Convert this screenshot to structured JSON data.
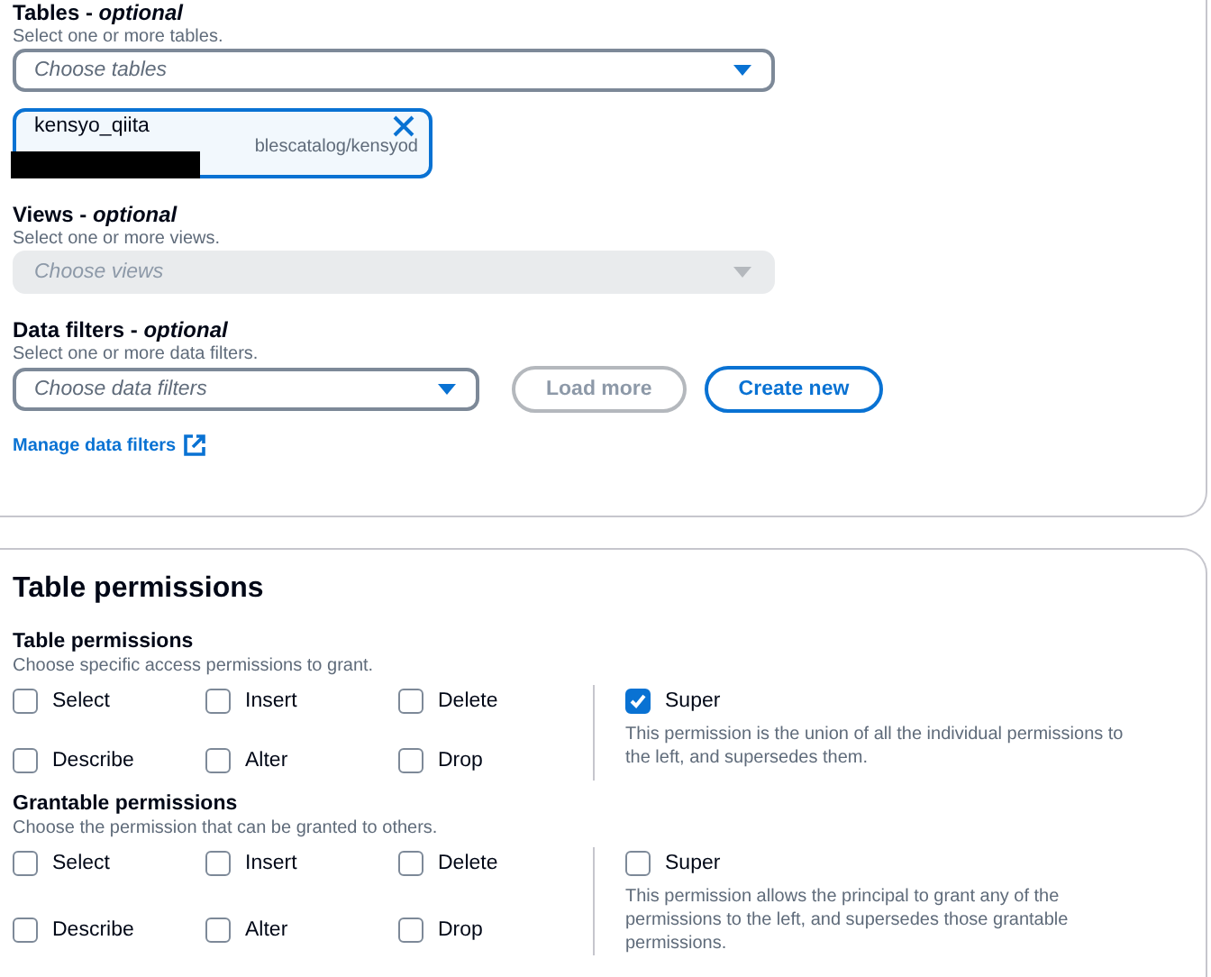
{
  "resource": {
    "tables": {
      "label": "Tables - *optional*",
      "description": "Select one or more tables.",
      "placeholder": "Choose tables",
      "disabled": false,
      "tokens": [
        {
          "label": "kensyo_qiita",
          "detail": "blescatalog/kensyod",
          "redacted": true
        }
      ]
    },
    "views": {
      "label": "Views - *optional*",
      "description": "Select one or more views.",
      "placeholder": "Choose views",
      "disabled": true
    },
    "data_filters": {
      "label": "Data filters - *optional*",
      "description": "Select one or more data filters.",
      "placeholder": "Choose data filters",
      "disabled": false,
      "buttons": [
        {
          "label": "Load more",
          "disabled": true
        },
        {
          "label": "Create new",
          "disabled": false
        }
      ],
      "link": "Manage data filters"
    }
  },
  "table_permissions": {
    "title": "Table permissions",
    "groups": [
      {
        "title": "Table permissions",
        "description": "Choose specific access permissions to grant.",
        "items": [
          {
            "label": "Select",
            "checked": false
          },
          {
            "label": "Insert",
            "checked": false
          },
          {
            "label": "Delete",
            "checked": false
          },
          {
            "label": "Describe",
            "checked": false
          },
          {
            "label": "Alter",
            "checked": false
          },
          {
            "label": "Drop",
            "checked": false
          }
        ],
        "super": {
          "label": "Super",
          "checked": true,
          "description": "This permission is the union of all the individual permissions to the left, and supersedes them."
        }
      },
      {
        "title": "Grantable permissions",
        "description": "Choose the permission that can be granted to others.",
        "items": [
          {
            "label": "Select",
            "checked": false
          },
          {
            "label": "Insert",
            "checked": false
          },
          {
            "label": "Delete",
            "checked": false
          },
          {
            "label": "Describe",
            "checked": false
          },
          {
            "label": "Alter",
            "checked": false
          },
          {
            "label": "Drop",
            "checked": false
          }
        ],
        "super": {
          "label": "Super",
          "checked": false,
          "description": "This permission allows the principal to grant any of the permissions to the left, and supersedes those grantable permissions."
        }
      }
    ]
  }
}
